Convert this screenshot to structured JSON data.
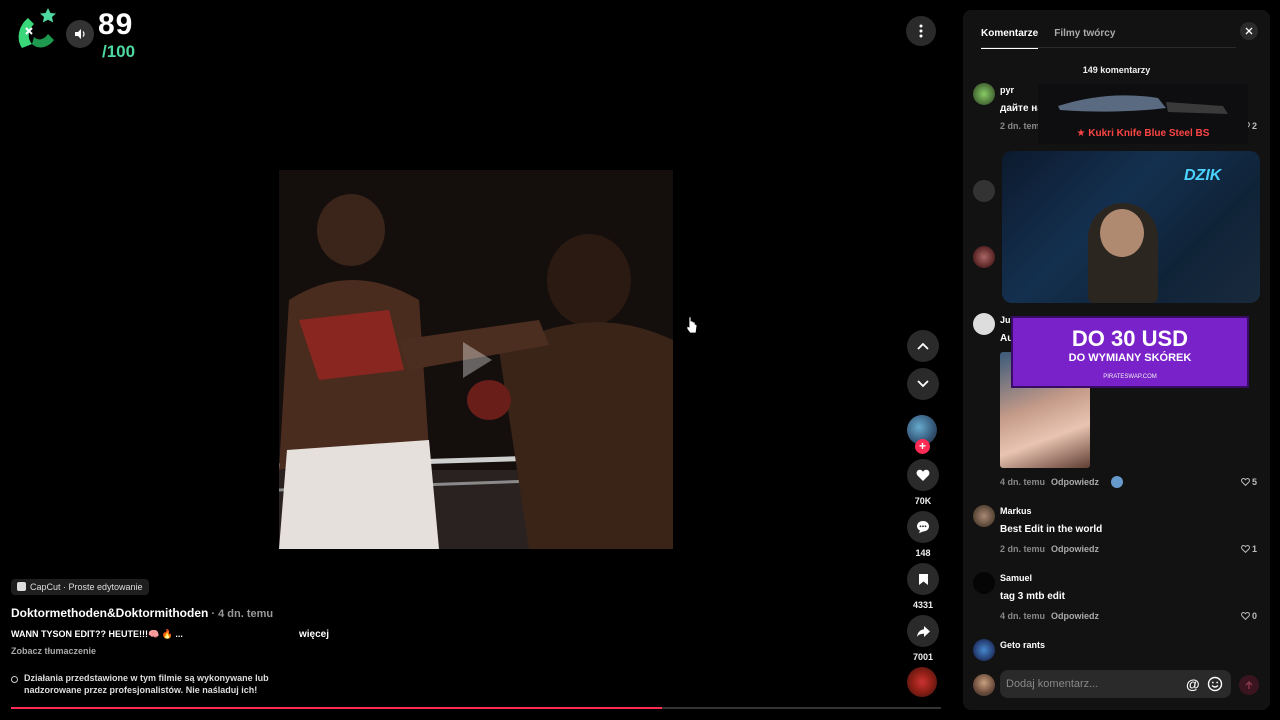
{
  "score": {
    "value": "89",
    "total": "/100"
  },
  "video": {
    "progress_percent": 70,
    "creator_label": "Doktormethoden&Doktormithoden",
    "date": " · 4 dn. temu",
    "tag": "CapCut · Proste edytowanie",
    "description": "WANN TYSON EDIT?? HEUTE!!!🧠 🔥 ...",
    "more_label": "więcej",
    "translate_label": "Zobacz tłumaczenie",
    "warning": "Działania przedstawione w tym filmie są wykonywane lub nadzorowane przez profesjonalistów. Nie naśladuj ich!"
  },
  "actions": {
    "likes": "70K",
    "comments": "148",
    "saves": "4331",
    "shares": "7001"
  },
  "panel": {
    "tabs": [
      {
        "label": "Komentarze"
      },
      {
        "label": "Filmy twórcy"
      }
    ],
    "comment_count": "149 komentarzy",
    "input_placeholder": "Dodaj komentarz...",
    "at_symbol": "@",
    "reply_label": "Odpowiedz",
    "comments": [
      {
        "name": "pyr",
        "text": "дайте на",
        "time": "2 dn. temu",
        "likes": "2"
      },
      {
        "name": "Jul",
        "text": "Au",
        "time": "4 dn. temu",
        "likes": "5"
      },
      {
        "name": "Markus",
        "text": "Best Edit in the world",
        "time": "2 dn. temu",
        "likes": "1"
      },
      {
        "name": "Samuel",
        "text": "tag 3 mtb edit",
        "time": "4 dn. temu",
        "likes": "0"
      },
      {
        "name": "Geto rants",
        "text": "",
        "time": "",
        "likes": ""
      }
    ]
  },
  "overlays": {
    "knife_caption": "★ Kukri Knife  Blue Steel BS",
    "stream_sign": "DZIK",
    "promo_big": "DO 30 USD",
    "promo_small": "DO WYMIANY SKÓREK",
    "promo_site": "PIRATESWAP.COM"
  },
  "colors": {
    "accent": "#fe2c55",
    "score_green": "#4dd8a0",
    "panel_bg": "#121212"
  }
}
